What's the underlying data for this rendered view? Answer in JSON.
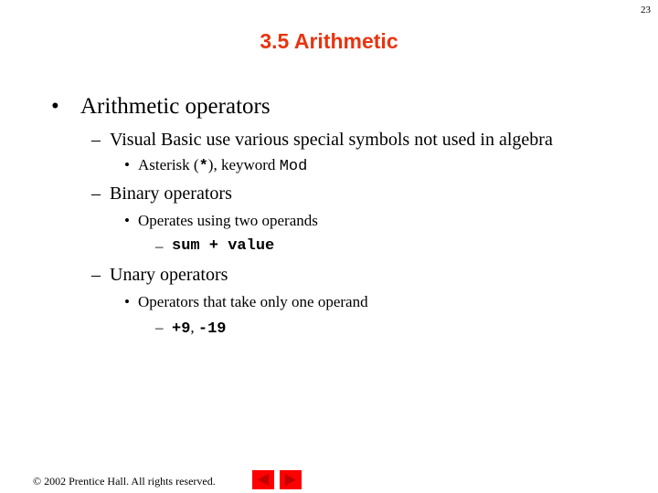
{
  "page_number": "23",
  "title": "3.5 Arithmetic",
  "content": {
    "bullet1": {
      "marker": "•",
      "text": "Arithmetic operators"
    },
    "sub1": {
      "marker": "–",
      "text": "Visual Basic use various special symbols not used in algebra"
    },
    "sub1_item1": {
      "marker": "•",
      "text_a": "Asterisk (",
      "code_a": "*",
      "text_b": "), keyword ",
      "code_b": "Mod"
    },
    "sub2": {
      "marker": "–",
      "text": "Binary operators"
    },
    "sub2_item1": {
      "marker": "•",
      "text": "Operates using two operands"
    },
    "sub2_item1_example": {
      "marker": "–",
      "code": "sum + value"
    },
    "sub3": {
      "marker": "–",
      "text": "Unary operators"
    },
    "sub3_item1": {
      "marker": "•",
      "text": "Operators that take only one operand"
    },
    "sub3_item1_example": {
      "marker": "–",
      "code_a": "+9",
      "sep": ", ",
      "code_b": "-19"
    }
  },
  "footer": {
    "copyright": "© 2002 Prentice Hall.  All rights reserved."
  },
  "nav": {
    "prev_icon": "left-triangle",
    "next_icon": "right-triangle",
    "button_color": "#ff0000",
    "arrow_color": "#c00000"
  }
}
